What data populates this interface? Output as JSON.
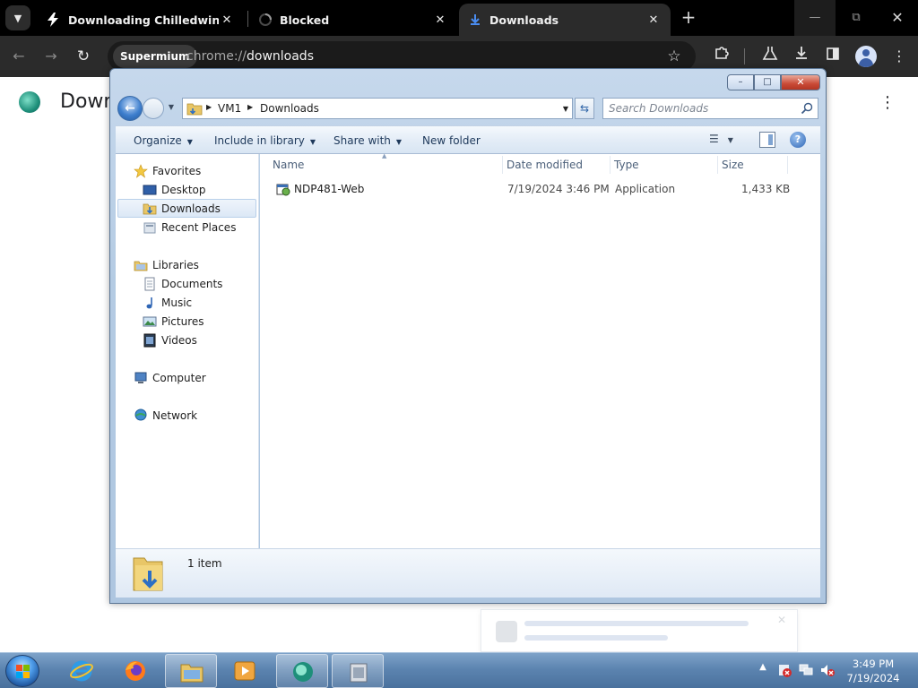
{
  "browser": {
    "tabs": [
      {
        "title": "Downloading Chilledwindows..."
      },
      {
        "title": "Blocked"
      },
      {
        "title": "Downloads"
      }
    ],
    "site_chip": "Supermium",
    "url_scheme": "chrome://",
    "url_host": "downloads"
  },
  "page": {
    "title": "Down"
  },
  "explorer": {
    "breadcrumb": [
      "VM1",
      "Downloads"
    ],
    "search_placeholder": "Search Downloads",
    "commands": {
      "organize": "Organize",
      "include_in_library": "Include in library",
      "share_with": "Share with",
      "new_folder": "New folder"
    },
    "nav": {
      "favorites": "Favorites",
      "desktop": "Desktop",
      "downloads": "Downloads",
      "recent_places": "Recent Places",
      "libraries": "Libraries",
      "documents": "Documents",
      "music": "Music",
      "pictures": "Pictures",
      "videos": "Videos",
      "computer": "Computer",
      "network": "Network"
    },
    "columns": {
      "name": "Name",
      "date_modified": "Date modified",
      "type": "Type",
      "size": "Size"
    },
    "files": [
      {
        "name": "NDP481-Web",
        "date_modified": "7/19/2024 3:46 PM",
        "type": "Application",
        "size": "1,433 KB"
      }
    ],
    "status": "1 item"
  },
  "taskbar": {
    "time": "3:49 PM",
    "date": "7/19/2024"
  },
  "colors": {
    "chrome_dark": "#2b2b2b",
    "aero_frame": "#b4cbe3",
    "taskbar": "#5c84b0",
    "selection": "#dce8f6"
  }
}
